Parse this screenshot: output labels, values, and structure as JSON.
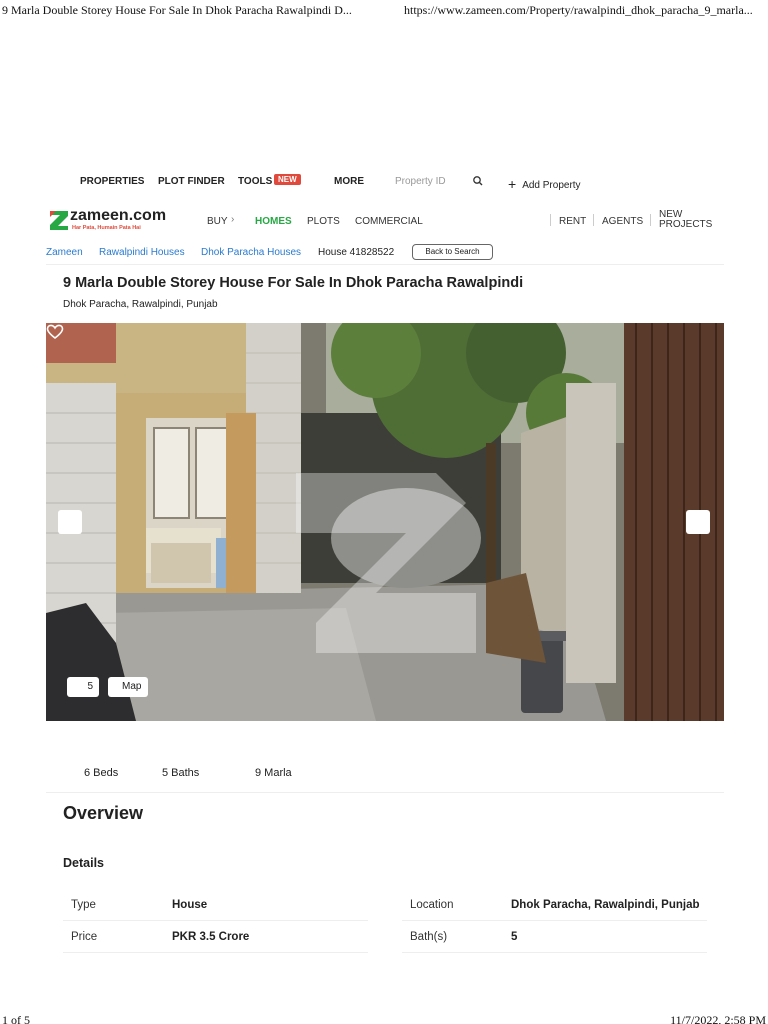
{
  "print": {
    "page_title": "9 Marla Double Storey House For Sale In Dhok Paracha Rawalpindi D...",
    "url": "https://www.zameen.com/Property/rawalpindi_dhok_paracha_9_marla...",
    "page_count": "1 of 5",
    "timestamp": "11/7/2022, 2:58 PM"
  },
  "topnav": {
    "properties": "PROPERTIES",
    "plot_finder": "PLOT FINDER",
    "tools": "TOOLS",
    "new_badge": "NEW",
    "more": "MORE",
    "property_id_placeholder": "Property ID",
    "add_property": "Add Property"
  },
  "brand": {
    "name": "zameen.com",
    "tagline": "Har Pata, Humain Pata Hai",
    "colors": {
      "green": "#28a745",
      "red": "#e04a3c",
      "link": "#2a7bd0"
    }
  },
  "mainnav": {
    "buy": "BUY",
    "homes": "HOMES",
    "plots": "PLOTS",
    "commercial": "COMMERCIAL",
    "rent": "RENT",
    "agents": "AGENTS",
    "new_projects_1": "NEW",
    "new_projects_2": "PROJECTS"
  },
  "breadcrumb": {
    "items": [
      "Zameen",
      "Rawalpindi Houses",
      "Dhok Paracha Houses"
    ],
    "current": "House 41828522",
    "back_label": "Back to Search"
  },
  "listing": {
    "title": "9 Marla Double Storey House For Sale In Dhok Paracha Rawalpindi",
    "location": "Dhok Paracha, Rawalpindi, Punjab"
  },
  "gallery": {
    "photo_count": "5",
    "map_label": "Map",
    "icons": [
      "chevron-left-icon",
      "chevron-right-icon",
      "camera-icon",
      "map-pin-icon",
      "heart-icon"
    ]
  },
  "specs": {
    "beds": "6 Beds",
    "baths": "5 Baths",
    "area": "9 Marla"
  },
  "overview": {
    "heading": "Overview",
    "details_heading": "Details",
    "rows": [
      {
        "label": "Type",
        "value": "House"
      },
      {
        "label": "Price",
        "value": "PKR 3.5 Crore"
      },
      {
        "label": "Location",
        "value": "Dhok Paracha, Rawalpindi, Punjab"
      },
      {
        "label": "Bath(s)",
        "value": "5"
      }
    ]
  }
}
